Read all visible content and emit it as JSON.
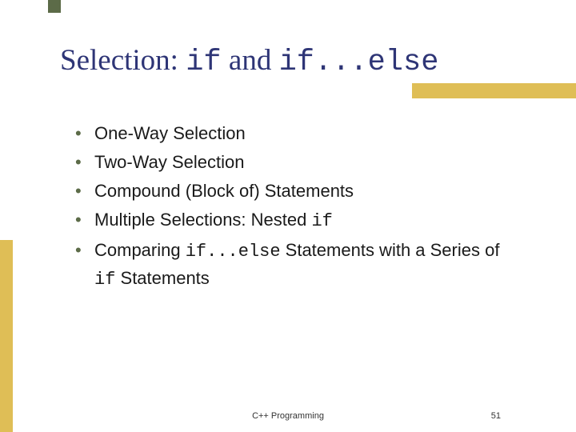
{
  "title": {
    "prefix": "Selection: ",
    "code1": "if",
    "mid": " and ",
    "code2": "if...else"
  },
  "bullets": [
    {
      "segments": [
        {
          "t": "One-Way Selection",
          "c": false
        }
      ]
    },
    {
      "segments": [
        {
          "t": "Two-Way Selection",
          "c": false
        }
      ]
    },
    {
      "segments": [
        {
          "t": "Compound (Block of) Statements",
          "c": false
        }
      ]
    },
    {
      "segments": [
        {
          "t": "Multiple Selections: Nested ",
          "c": false
        },
        {
          "t": "if",
          "c": true
        }
      ]
    },
    {
      "segments": [
        {
          "t": "Comparing ",
          "c": false
        },
        {
          "t": "if...else",
          "c": true
        },
        {
          "t": " Statements with a Series of ",
          "c": false
        },
        {
          "t": "if",
          "c": true
        },
        {
          "t": " Statements",
          "c": false
        }
      ]
    }
  ],
  "footer": "C++ Programming",
  "page": "51"
}
